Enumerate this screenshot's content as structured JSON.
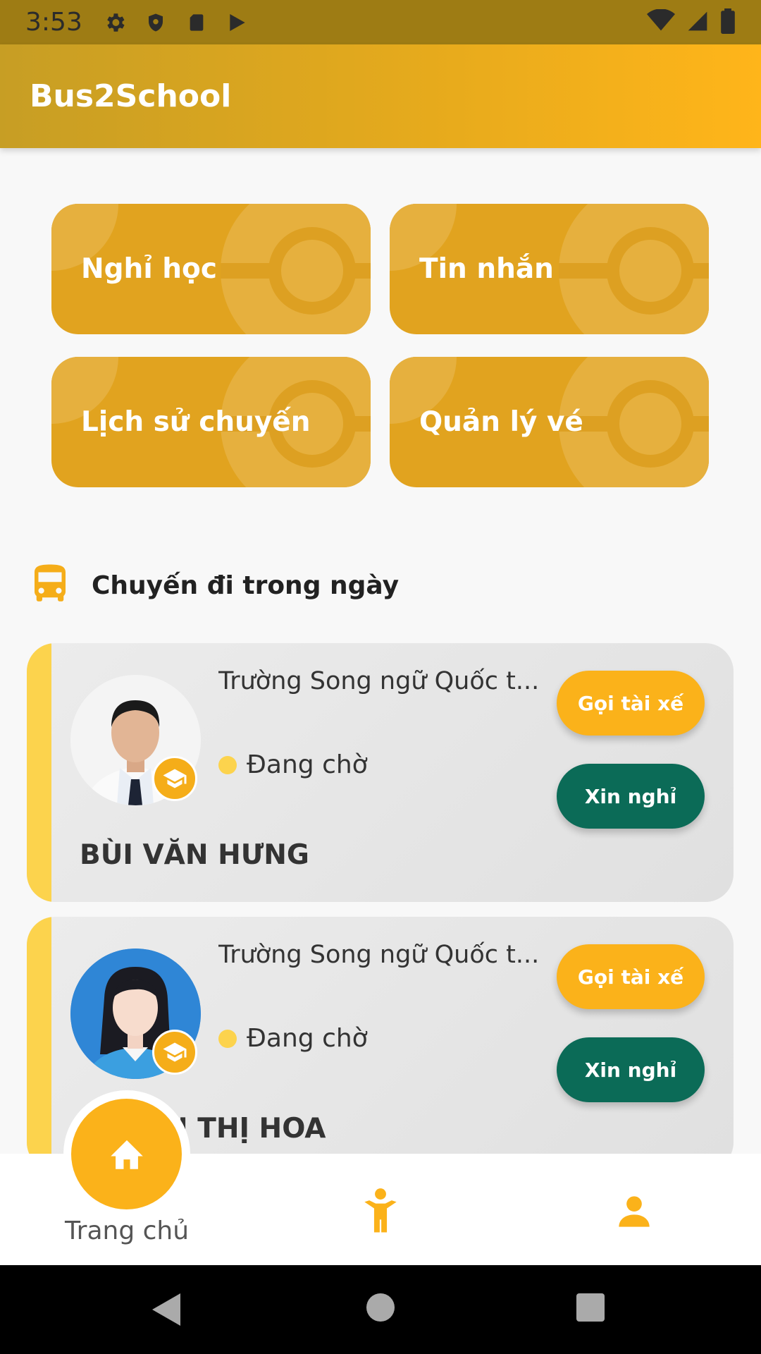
{
  "status_bar": {
    "time": "3:53",
    "icons": [
      "settings-icon",
      "shield-icon",
      "sd-card-icon",
      "play-store-icon",
      "wifi-icon",
      "signal-icon",
      "battery-icon"
    ]
  },
  "app_bar": {
    "title": "Bus2School"
  },
  "actions": [
    {
      "label": "Nghỉ học",
      "icon": "none"
    },
    {
      "label": "Tin nhắn",
      "icon": "none"
    },
    {
      "label": "Lịch sử chuyến",
      "icon": "none"
    },
    {
      "label": "Quản lý vé",
      "icon": "none"
    }
  ],
  "section": {
    "title": "Chuyến đi trong ngày",
    "icon": "bus-icon"
  },
  "trips": [
    {
      "school": "Trường Song ngữ Quốc t...",
      "status": "Đang chờ",
      "student_name": "BÙI VĂN HƯNG",
      "call_label": "Gọi tài xế",
      "leave_label": "Xin nghỉ"
    },
    {
      "school": "Trường Song ngữ Quốc t...",
      "status": "Đang chờ",
      "student_name": "N THỊ HOA",
      "call_label": "Gọi tài xế",
      "leave_label": "Xin nghỉ"
    }
  ],
  "bottom_nav": {
    "items": [
      {
        "label": "Trang chủ",
        "icon": "home-icon",
        "active": true
      },
      {
        "label": "",
        "icon": "child-icon",
        "active": false
      },
      {
        "label": "",
        "icon": "person-icon",
        "active": false
      }
    ]
  },
  "colors": {
    "accent": "#fbb21a",
    "tile": "#e1a31f",
    "leave_button": "#0b6b57",
    "stripe": "#fcd34d"
  }
}
